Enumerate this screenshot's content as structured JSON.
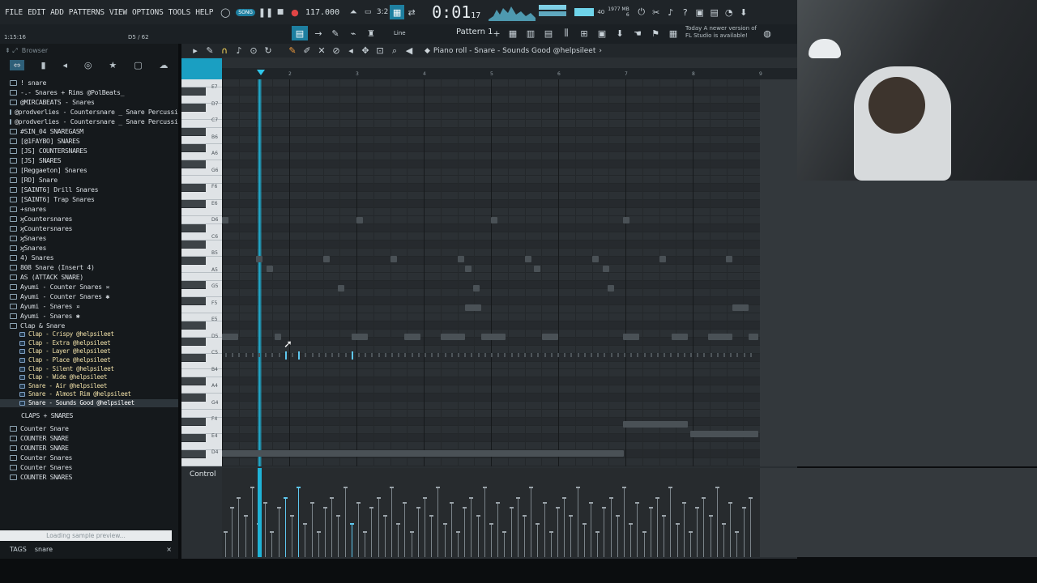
{
  "menu": [
    "FILE",
    "EDIT",
    "ADD",
    "PATTERNS",
    "VIEW",
    "OPTIONS",
    "TOOLS",
    "HELP"
  ],
  "transport": {
    "mode": "SONG",
    "tempo": "117.000",
    "time": "0:01",
    "time_small": "17",
    "cpu": "1977 MB",
    "cpu_small": "6",
    "voices": "40"
  },
  "notice": {
    "line1": "Today  A newer version of",
    "line2": "FL Studio is available!"
  },
  "hint": {
    "left": "1:15:16",
    "right": "D5 / 62"
  },
  "pattern": {
    "label": "Pattern 1",
    "snap": "Line"
  },
  "browser": {
    "title": "Browser",
    "items": [
      "! snare",
      "-.- Snares + Rims @PolBeats_",
      "@MIRCABEATS - Snares",
      "@prodverlies - Countersnare _ Snare Percussion",
      "@prodverlies - Countersnare _ Snare Percussion",
      "#SIN_04 SNAREGASM",
      "[@1FAYBO] SNARES",
      "[JS] COUNTERSNARES",
      "[JS] SNARES",
      "[Reggaeton] Snares",
      "[RO] Snare",
      "[SAINT6] Drill Snares",
      "[SAINT6] Trap Snares",
      "+snares",
      "ϗCountersnares",
      "ϗCountersnares",
      "ϗSnares",
      "ϗSnares",
      "4) Snares",
      "808 Snare (Insert 4)",
      "AS (ATTACK SNARE)",
      "Ayumi - Counter Snares ¤",
      "Ayumi - Counter Snares ✱",
      "Ayumi - Snares ¤",
      "Ayumi - Snares ✱",
      "Clap & Snare"
    ],
    "subitems": [
      "Clap - Crispy @helpsileet",
      "Clap - Extra @helpsileet",
      "Clap - Layer @helpsileet",
      "Clap - Place @helpsileet",
      "Clap - Silent @helpsileet",
      "Clap - Wide @helpsileet",
      "Snare - Air @helpsileet",
      "Snare - Almost Rim @helpsileet",
      "Snare - Sounds Good @helpsileet"
    ],
    "group2_title": "CLAPS + SNARES",
    "group2": [
      "Counter Snare",
      "COUNTER SNARE",
      "COUNTER SNARE",
      "Counter Snares",
      "Counter Snares",
      "COUNTER SNARES"
    ],
    "loading": "Loading sample preview...",
    "tags_label": "TAGS",
    "tags_value": "snare"
  },
  "pianoroll": {
    "title": "Piano roll - Snare - Sounds Good @helpsileet",
    "bars": [
      "2",
      "3",
      "4",
      "5",
      "6",
      "7",
      "8",
      "9"
    ],
    "keys": [
      "E7",
      "D7",
      "C7",
      "B6",
      "A6",
      "G6",
      "F6",
      "E6",
      "D6",
      "C6",
      "B5",
      "A5",
      "G5",
      "F5",
      "E5",
      "D5",
      "C5",
      "B4",
      "A4",
      "G4",
      "F4",
      "E4",
      "D4"
    ],
    "control_label": "Control"
  },
  "colors": {
    "accent": "#1fb4d8",
    "bg": "#2b3034",
    "note": "#4a5156"
  }
}
